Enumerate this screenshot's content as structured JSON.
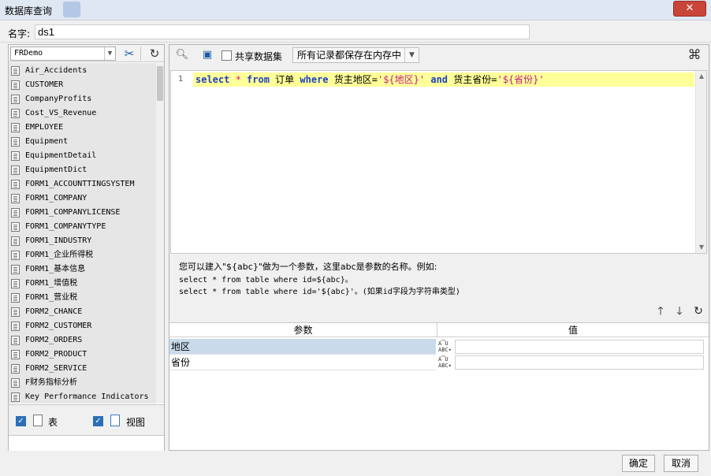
{
  "window": {
    "title": "数据库查询"
  },
  "name_field": {
    "label": "名字:",
    "value": "ds1"
  },
  "left": {
    "connection": "FRDemo",
    "tables": [
      "Air_Accidents",
      "CUSTOMER",
      "CompanyProfits",
      "Cost_VS_Revenue",
      "EMPLOYEE",
      "Equipment",
      "EquipmentDetail",
      "EquipmentDict",
      "FORM1_ACCOUNTTINGSYSTEM",
      "FORM1_COMPANY",
      "FORM1_COMPANYLICENSE",
      "FORM1_COMPANYTYPE",
      "FORM1_INDUSTRY",
      "FORM1_企业所得税",
      "FORM1_基本信息",
      "FORM1_增值税",
      "FORM1_营业税",
      "FORM2_CHANCE",
      "FORM2_CUSTOMER",
      "FORM2_ORDERS",
      "FORM2_PRODUCT",
      "FORM2_SERVICE",
      "F财务指标分析",
      "Key Performance Indicators"
    ],
    "filter_table_label": "表",
    "filter_view_label": "视图"
  },
  "right": {
    "share_label": "共享数据集",
    "mode": "所有记录都保存在内存中",
    "editor": {
      "line_number": "1",
      "sql": {
        "kw_select": "select",
        "star": " * ",
        "kw_from": "from",
        "t1": " 订单  ",
        "kw_where": "where",
        "t2": " 货主地区=",
        "s1": "'${地区}'",
        "t3": " ",
        "kw_and": "and",
        "t4": " 货主省份=",
        "s2": "'${省份}'"
      }
    },
    "hint": {
      "line1": "您可以建入\"${abc}\"做为一个参数，这里abc是参数的名称。例如:",
      "line2": "select * from table where id=${abc}。",
      "line3": "select * from table where id='${abc}'。(如果id字段为字符串类型)"
    },
    "params": {
      "col_param": "参数",
      "col_value": "值",
      "rows": [
        {
          "name": "地区",
          "type": "A͡U ABC",
          "value": ""
        },
        {
          "name": "省份",
          "type": "A͡U ABC",
          "value": ""
        }
      ]
    }
  },
  "footer": {
    "ok": "确定",
    "cancel": "取消"
  }
}
